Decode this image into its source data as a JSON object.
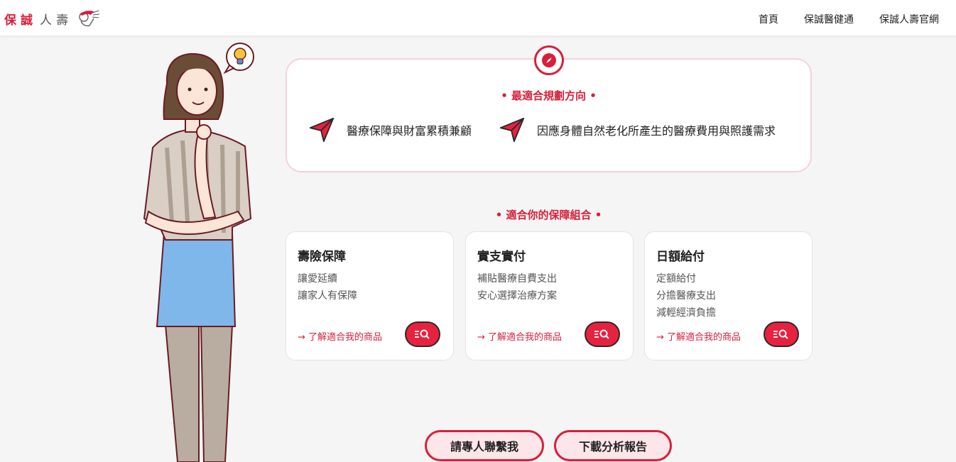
{
  "header": {
    "logo_red": "保誠",
    "logo_grey": "人壽",
    "nav": [
      "首頁",
      "保誠醫健通",
      "保誠人壽官網"
    ]
  },
  "direction": {
    "title": "• 最適合規劃方向 •",
    "items": [
      "醫療保障與財富累積兼顧",
      "因應身體自然老化所產生的醫療費用與照護需求"
    ]
  },
  "combo_title": "• 適合你的保障組合 •",
  "cards": [
    {
      "title": "壽險保障",
      "lines": [
        "讓愛延續",
        "讓家人有保障"
      ],
      "link": "→ 了解適合我的商品"
    },
    {
      "title": "實支實付",
      "lines": [
        "補貼醫療自費支出",
        "安心選擇治療方案"
      ],
      "link": "→ 了解適合我的商品"
    },
    {
      "title": "日額給付",
      "lines": [
        "定額給付",
        "分擔醫療支出",
        "減輕經濟負擔"
      ],
      "link": "→ 了解適合我的商品"
    }
  ],
  "buttons": {
    "contact": "請專人聯繫我",
    "download": "下載分析報告"
  },
  "colors": {
    "brand_red": "#d71f3a",
    "page_bg": "#f5f5f5"
  }
}
